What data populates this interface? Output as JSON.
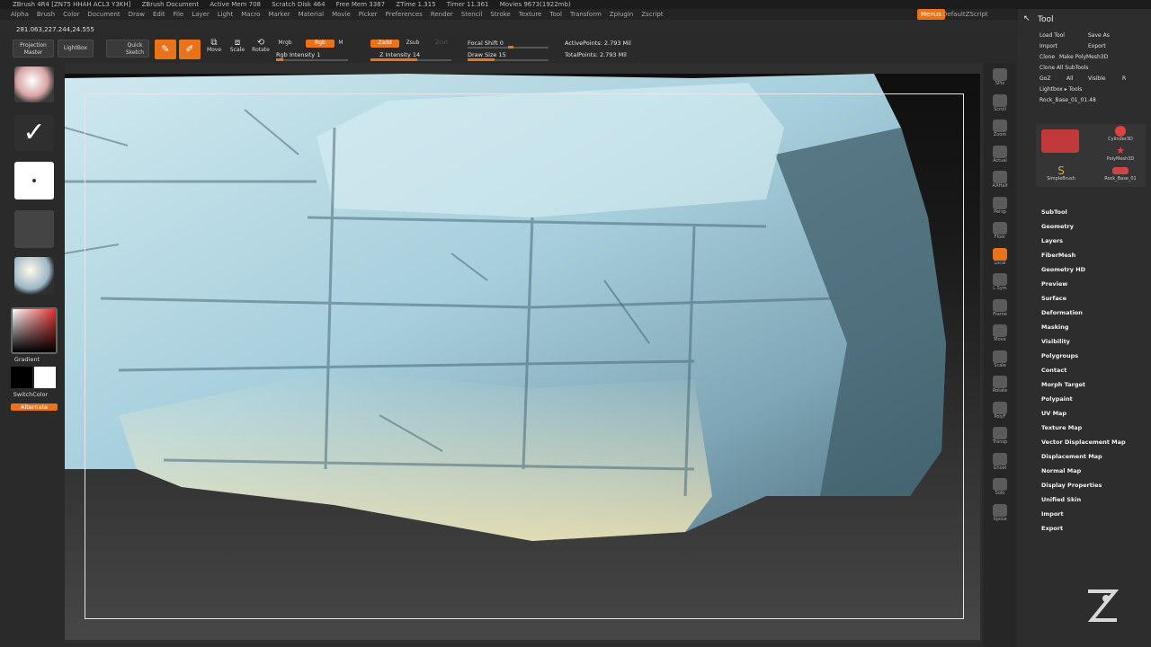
{
  "titlebar": {
    "app": "ZBrush 4R4 [ZN75 HHAH ACL3 Y3KH]",
    "doc": "ZBrush Document",
    "active_mem": "Active Mem 708",
    "scratch": "Scratch Disk 464",
    "free_mem": "Free Mem 3387",
    "ztime": "ZTime 1.315",
    "timer": "Timer 11.361",
    "movies": "Movies 9673(1922mb)"
  },
  "menu": {
    "items": [
      "Alpha",
      "Brush",
      "Color",
      "Document",
      "Draw",
      "Edit",
      "File",
      "Layer",
      "Light",
      "Macro",
      "Marker",
      "Material",
      "Movie",
      "Picker",
      "Preferences",
      "Render",
      "Stencil",
      "Stroke",
      "Texture",
      "Tool",
      "Transform",
      "Zplugin",
      "Zscript"
    ],
    "menus_btn": "Menus",
    "default_script": "DefaultZScript"
  },
  "coords": "281.063,227.244,24.555",
  "shelf": {
    "projection_master": "Projection Master",
    "lightbox": "LightBox",
    "quick_sketch": "Quick Sketch",
    "edit": "Edit",
    "draw": "Draw",
    "move": "Move",
    "scale": "Scale",
    "rotate": "Rotate",
    "mrgb": "Mrgb",
    "rgb": "Rgb",
    "m": "M",
    "zadd": "Zadd",
    "zsub": "Zsub",
    "zcut": "Zcut",
    "rgb_intensity": "Rgb Intensity 1",
    "z_intensity": "Z Intensity 14",
    "focal_shift": "Focal Shift 0",
    "draw_size": "Draw Size 15",
    "active_points": "ActivePoints: 2.793 Mil",
    "total_points": "TotalPoints: 2.793 Mil"
  },
  "left": {
    "gradient": "Gradient",
    "switch_color": "SwitchColor",
    "alternate": "Alternate"
  },
  "right_shelf": [
    "SPix",
    "Scroll",
    "Zoom",
    "Actual",
    "AAHalf",
    "Persp",
    "Floor",
    "Local",
    "L.Sym",
    "Frame",
    "Move",
    "Scale",
    "Rotate",
    "PolyF",
    "Transp",
    "Ghost",
    "Solo",
    "Xpose"
  ],
  "tray": {
    "title": "Tool",
    "load_tool": "Load Tool",
    "save_as": "Save As",
    "import": "Import",
    "export": "Export",
    "clone": "Clone",
    "make_polymesh": "Make PolyMesh3D",
    "clone_all": "Clone All SubTools",
    "goz": "GoZ",
    "all": "All",
    "visible": "Visible",
    "r": "R",
    "lightbox_tools": "Lightbox ▸ Tools",
    "current_tool": "Rock_Base_01_01.48",
    "thumbs": [
      "Cylinder3D",
      "PolyMesh3D",
      "SimpleBrush",
      "Rock_Base_01"
    ],
    "subs": [
      "SubTool",
      "Geometry",
      "Layers",
      "FiberMesh",
      "Geometry HD",
      "Preview",
      "Surface",
      "Deformation",
      "Masking",
      "Visibility",
      "Polygroups",
      "Contact",
      "Morph Target",
      "Polypaint",
      "UV Map",
      "Texture Map",
      "Vector Displacement Map",
      "Displacement Map",
      "Normal Map",
      "Display Properties",
      "Unified Skin",
      "Import",
      "Export"
    ]
  },
  "colors": {
    "accent": "#e8731a",
    "rock": "#9fc7d6"
  }
}
